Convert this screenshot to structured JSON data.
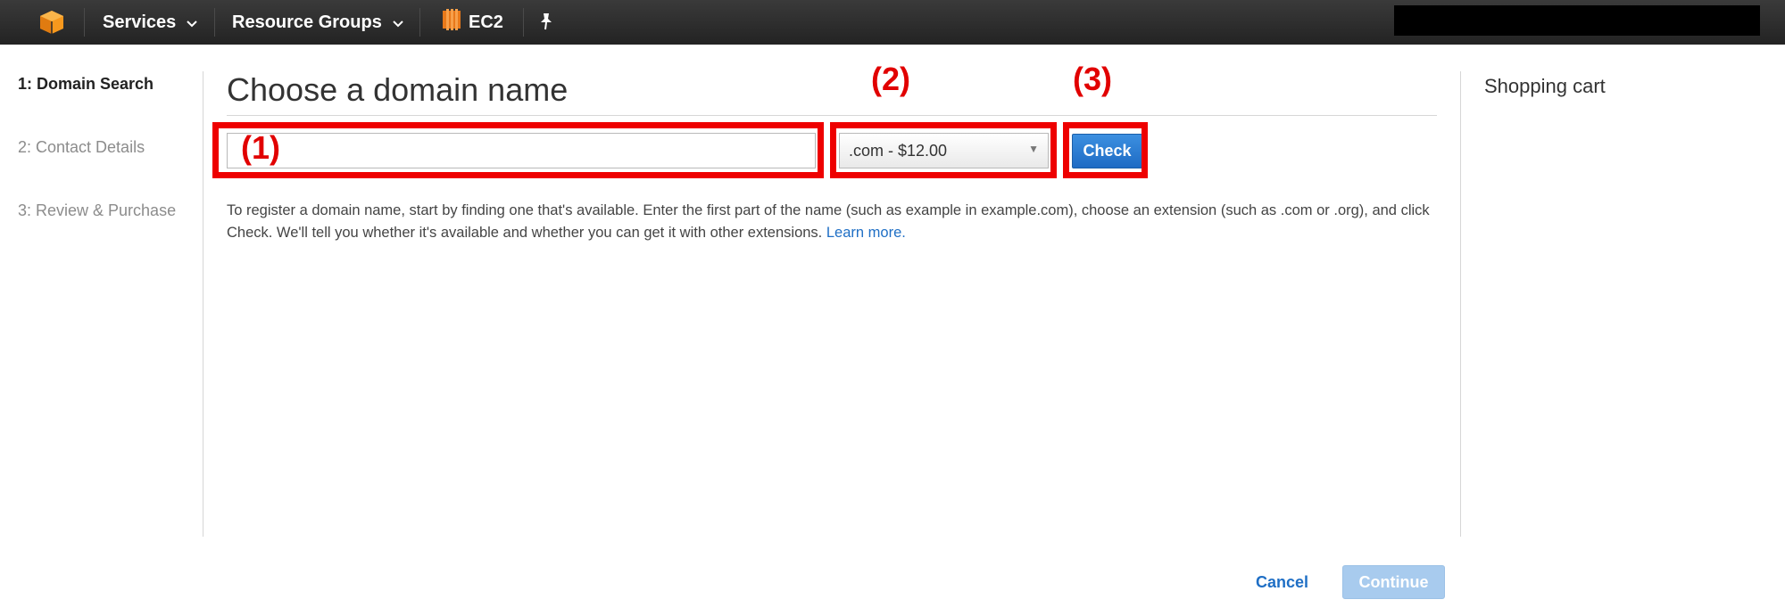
{
  "topbar": {
    "services_label": "Services",
    "resource_groups_label": "Resource Groups",
    "ec2_label": "EC2"
  },
  "sidebar": {
    "steps": [
      {
        "label": "1: Domain Search",
        "active": true
      },
      {
        "label": "2: Contact Details",
        "active": false
      },
      {
        "label": "3: Review & Purchase",
        "active": false
      }
    ]
  },
  "main": {
    "title": "Choose a domain name",
    "domain_input_value": "",
    "tld_selected": ".com - $12.00",
    "check_label": "Check",
    "help_text": "To register a domain name, start by finding one that's available. Enter the first part of the name (such as example in example.com), choose an extension (such as .com or .org), and click Check. We'll tell you whether it's available and whether you can get it with other extensions.",
    "learn_more": "Learn more."
  },
  "annotations": {
    "label_1": "(1)",
    "label_2": "(2)",
    "label_3": "(3)"
  },
  "cart": {
    "title": "Shopping cart"
  },
  "footer": {
    "cancel_label": "Cancel",
    "continue_label": "Continue"
  },
  "colors": {
    "accent_blue": "#1f6fc5",
    "annotation_red": "#ee0000",
    "topbar_bg": "#2b2b2b",
    "aws_orange": "#f7981d"
  }
}
